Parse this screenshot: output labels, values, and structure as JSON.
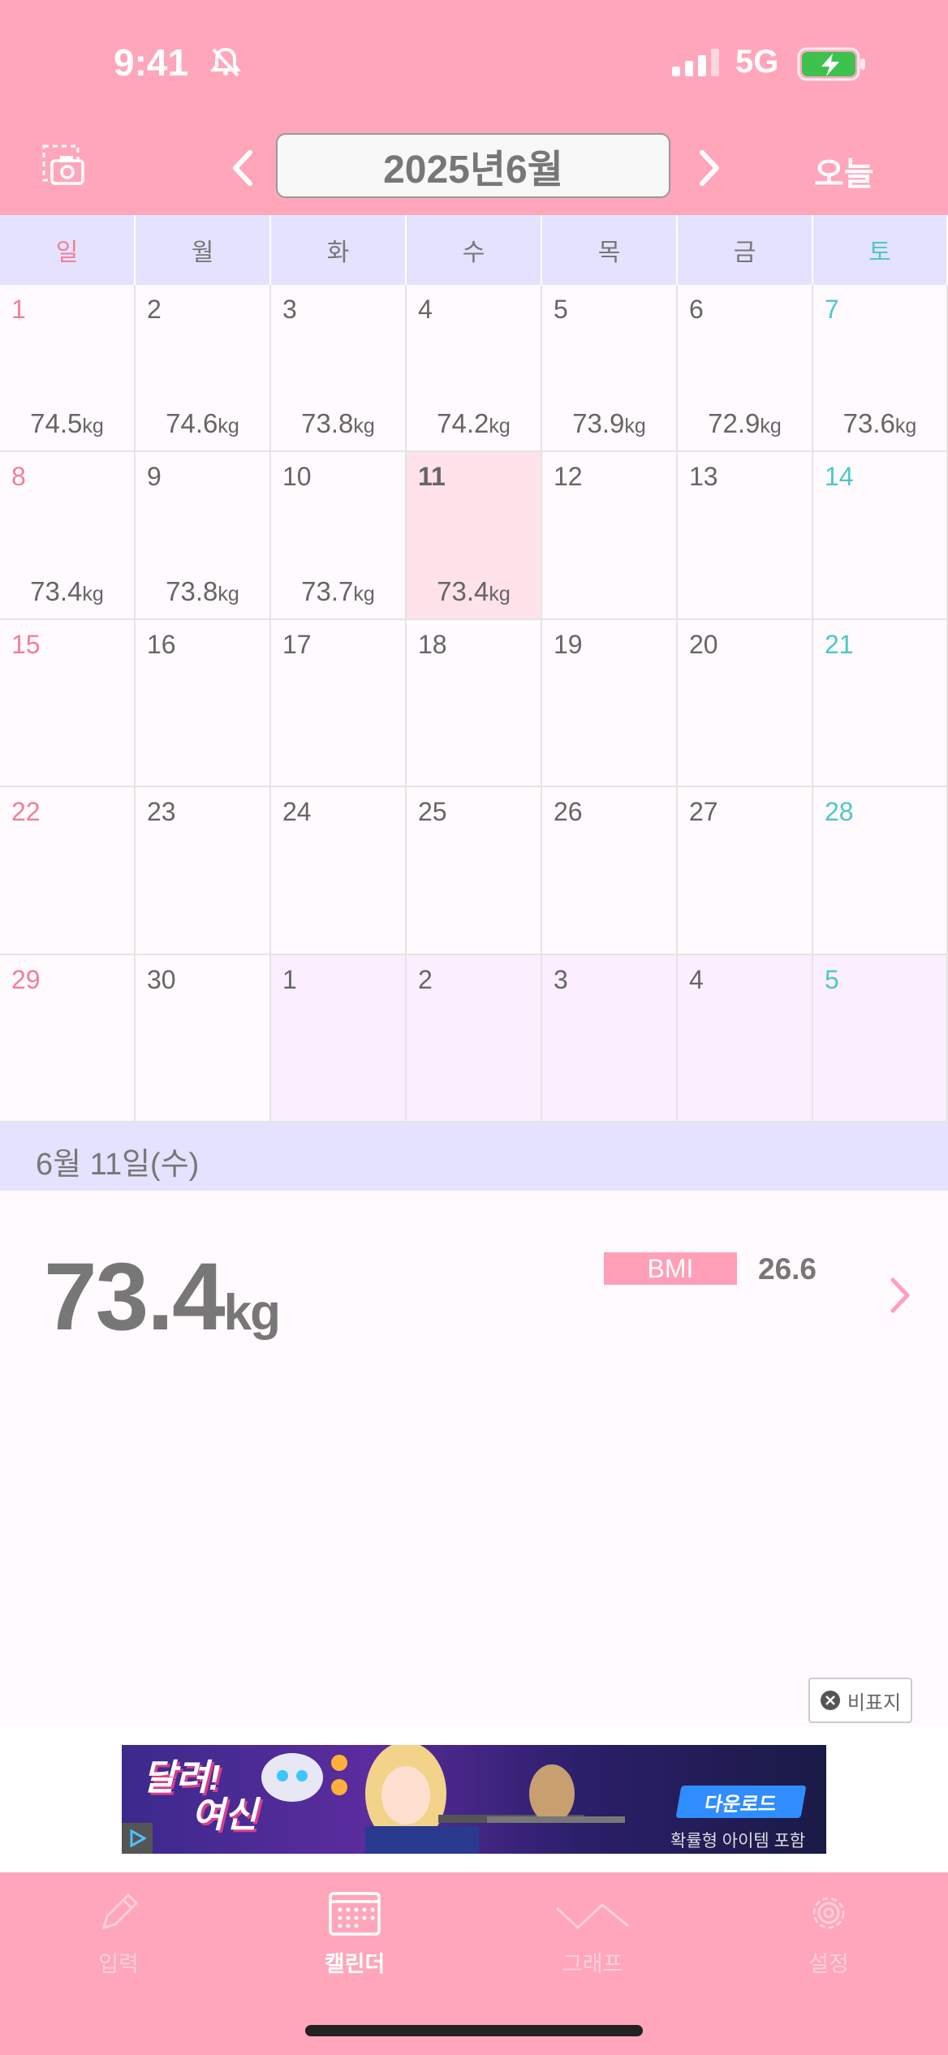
{
  "status": {
    "time": "9:41",
    "network": "5G"
  },
  "header": {
    "month_title": "2025년6월",
    "today_label": "오늘"
  },
  "weekdays": [
    "일",
    "월",
    "화",
    "수",
    "목",
    "금",
    "토"
  ],
  "calendar": {
    "weeks": [
      [
        {
          "day": "1",
          "weight": "74.5"
        },
        {
          "day": "2",
          "weight": "74.6"
        },
        {
          "day": "3",
          "weight": "73.8"
        },
        {
          "day": "4",
          "weight": "74.2"
        },
        {
          "day": "5",
          "weight": "73.9"
        },
        {
          "day": "6",
          "weight": "72.9"
        },
        {
          "day": "7",
          "weight": "73.6"
        }
      ],
      [
        {
          "day": "8",
          "weight": "73.4"
        },
        {
          "day": "9",
          "weight": "73.8"
        },
        {
          "day": "10",
          "weight": "73.7"
        },
        {
          "day": "11",
          "weight": "73.4",
          "selected": true
        },
        {
          "day": "12",
          "weight": ""
        },
        {
          "day": "13",
          "weight": ""
        },
        {
          "day": "14",
          "weight": ""
        }
      ],
      [
        {
          "day": "15",
          "weight": ""
        },
        {
          "day": "16",
          "weight": ""
        },
        {
          "day": "17",
          "weight": ""
        },
        {
          "day": "18",
          "weight": ""
        },
        {
          "day": "19",
          "weight": ""
        },
        {
          "day": "20",
          "weight": ""
        },
        {
          "day": "21",
          "weight": ""
        }
      ],
      [
        {
          "day": "22",
          "weight": ""
        },
        {
          "day": "23",
          "weight": ""
        },
        {
          "day": "24",
          "weight": ""
        },
        {
          "day": "25",
          "weight": ""
        },
        {
          "day": "26",
          "weight": ""
        },
        {
          "day": "27",
          "weight": ""
        },
        {
          "day": "28",
          "weight": ""
        }
      ],
      [
        {
          "day": "29",
          "weight": ""
        },
        {
          "day": "30",
          "weight": ""
        },
        {
          "day": "1",
          "weight": "",
          "other": true
        },
        {
          "day": "2",
          "weight": "",
          "other": true
        },
        {
          "day": "3",
          "weight": "",
          "other": true
        },
        {
          "day": "4",
          "weight": "",
          "other": true
        },
        {
          "day": "5",
          "weight": "",
          "other": true
        }
      ]
    ],
    "unit": "kg"
  },
  "detail": {
    "date_label": "6월 11일(수)",
    "weight": "73.4",
    "unit": "kg",
    "bmi_label": "BMI",
    "bmi_value": "26.6"
  },
  "ad": {
    "hide_label": "비표지",
    "title_line1": "달려!",
    "title_line2": "여신",
    "download_label": "다운로드",
    "note": "확률형 아이템 포함"
  },
  "tabs": [
    {
      "label": "입력",
      "icon": "pencil-icon"
    },
    {
      "label": "캘린더",
      "icon": "calendar-icon",
      "active": true
    },
    {
      "label": "그래프",
      "icon": "graph-icon"
    },
    {
      "label": "설정",
      "icon": "gear-icon"
    }
  ],
  "colors": {
    "header": "#ffa6bb",
    "weekday_bar": "#e4e2ff",
    "sunday": "#f27f97",
    "saturday": "#4ec7c8",
    "selected_cell": "#ffe2ea"
  }
}
